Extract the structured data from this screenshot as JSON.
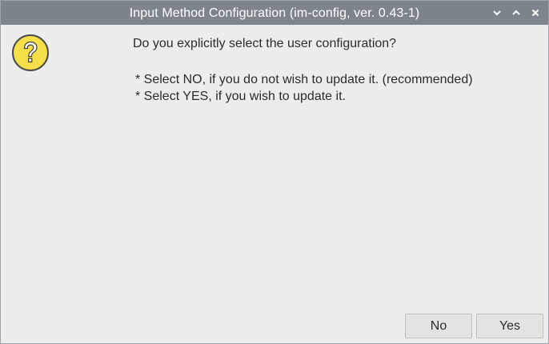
{
  "window": {
    "title": "Input Method Configuration (im-config, ver. 0.43-1)",
    "controls": [
      "chevron-down-icon",
      "chevron-up-icon",
      "close-icon"
    ]
  },
  "dialog": {
    "icon": "question-icon",
    "question": "Do you explicitly select the user configuration?",
    "details": [
      "* Select NO, if you do not wish to update it. (recommended)",
      "* Select YES, if you wish to update it."
    ]
  },
  "buttons": {
    "no_label": "No",
    "yes_label": "Yes"
  },
  "colors": {
    "titlebar": "#7d848c",
    "background": "#ededed",
    "icon_fill": "#f5e04a"
  }
}
